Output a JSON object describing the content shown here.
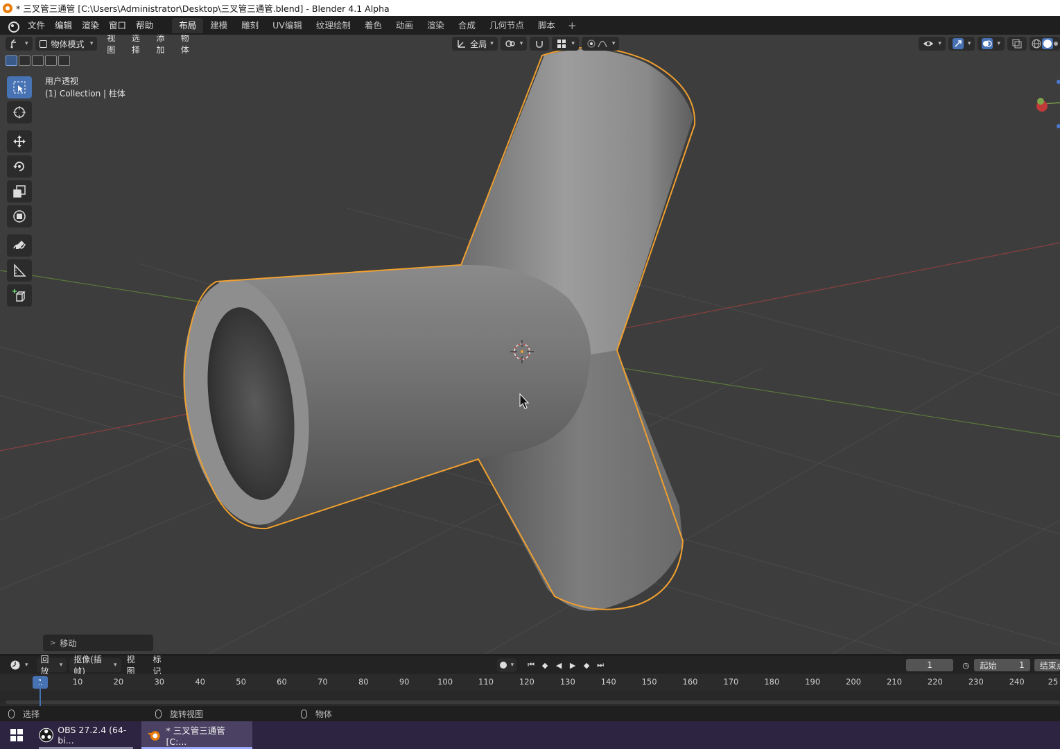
{
  "window": {
    "title": "* 三叉管三通管 [C:\\Users\\Administrator\\Desktop\\三叉管三通管.blend] - Blender 4.1 Alpha"
  },
  "menu": {
    "items": [
      "文件",
      "编辑",
      "渲染",
      "窗口",
      "帮助"
    ]
  },
  "workspaces": {
    "tabs": [
      "布局",
      "建模",
      "雕刻",
      "UV编辑",
      "纹理绘制",
      "着色",
      "动画",
      "渲染",
      "合成",
      "几何节点",
      "脚本"
    ],
    "active": "布局"
  },
  "viewport_header": {
    "mode": "物体模式",
    "menus": [
      "视图",
      "选择",
      "添加",
      "物体"
    ],
    "transform_orientation": "全局"
  },
  "viewport": {
    "view_name": "用户透视",
    "collection_info": "(1) Collection | 柱体",
    "last_operator": "移动"
  },
  "timeline": {
    "playback": "回放",
    "keying": "抠像(插帧)",
    "view": "视图",
    "marker": "标记",
    "current_frame": "1",
    "start_label": "起始",
    "start_frame": "1",
    "end_label": "结束点",
    "ruler_ticks": [
      "10",
      "20",
      "30",
      "40",
      "50",
      "60",
      "70",
      "80",
      "90",
      "100",
      "110",
      "120",
      "130",
      "140",
      "150",
      "160",
      "170",
      "180",
      "190",
      "200",
      "210",
      "220",
      "230",
      "240",
      "25"
    ],
    "badge_frame": "1"
  },
  "statusbar": {
    "left": "选择",
    "middle": "旋转视图",
    "right": "物体"
  },
  "taskbar": {
    "apps": [
      {
        "label": "OBS 27.2.4 (64-bi...",
        "icon": "obs-icon"
      },
      {
        "label": "* 三叉管三通管 [C:...",
        "icon": "blender-icon"
      }
    ]
  },
  "colors": {
    "viewport_bg": "#3d3d3d",
    "selection_outline": "#f0a030",
    "active_tool": "#4772b3",
    "x_axis": "#b84848",
    "y_axis": "#7ea34a"
  }
}
